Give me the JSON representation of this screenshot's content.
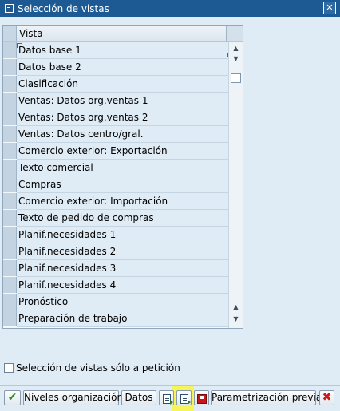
{
  "window": {
    "title": "Selección de vistas",
    "close_label": "✕"
  },
  "grid": {
    "column_header": "Vista",
    "rows": [
      "Datos base 1",
      "Datos base 2",
      "Clasificación",
      "Ventas: Datos org.ventas 1",
      "Ventas: Datos org.ventas 2",
      "Ventas: Datos centro/gral.",
      "Comercio exterior: Exportación",
      "Texto comercial",
      "Compras",
      "Comercio exterior: Importación",
      "Texto de pedido de compras",
      "Planif.necesidades 1",
      "Planif.necesidades 2",
      "Planif.necesidades 3",
      "Planif.necesidades 4",
      "Pronóstico",
      "Preparación de trabajo"
    ]
  },
  "option": {
    "label": "Selección de vistas sólo a petición",
    "checked": false
  },
  "toolbar": {
    "confirm_icon": "check-icon",
    "org_levels_label": "Niveles organización",
    "data_label": "Datos",
    "select_all_icon": "select-all-icon",
    "deselect_all_icon": "deselect-all-icon",
    "save_icon": "save-icon",
    "default_values_label": "Parametrización previa",
    "cancel_icon": "cancel-icon",
    "highlight_color": "#f5f55a"
  }
}
